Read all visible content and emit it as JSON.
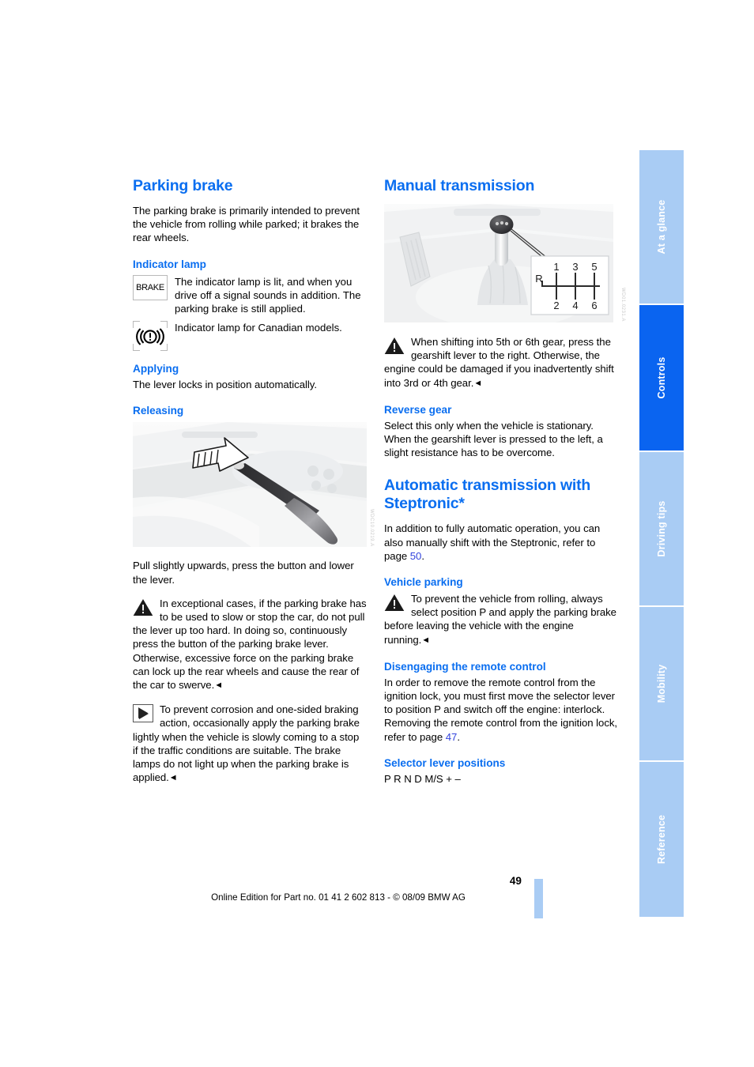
{
  "page": {
    "number": "49",
    "footer": "Online Edition for Part no. 01 41 2 602 813 - © 08/09 BMW AG"
  },
  "sidebar": {
    "tabs": [
      {
        "label": "At a glance",
        "active": false
      },
      {
        "label": "Controls",
        "active": true
      },
      {
        "label": "Driving tips",
        "active": false
      },
      {
        "label": "Mobility",
        "active": false
      },
      {
        "label": "Reference",
        "active": false
      }
    ]
  },
  "colors": {
    "heading_blue": "#0a6ef0",
    "tab_active": "#0a64f0",
    "tab_inactive": "#a9ccf4",
    "xref_blue": "#3344dd"
  },
  "left_column": {
    "title": "Parking brake",
    "intro": "The parking brake is primarily intended to prevent the vehicle from rolling while parked; it brakes the rear wheels.",
    "indicator_heading": "Indicator lamp",
    "lamp_brake_label": "BRAKE",
    "lamp_brake_text": "The indicator lamp is lit, and when you drive off a signal sounds in addition. The parking brake is still applied.",
    "lamp_canadian_glyph": "((!))",
    "lamp_canadian_text": "Indicator lamp for Canadian models.",
    "applying_heading": "Applying",
    "applying_text": "The lever locks in position automatically.",
    "releasing_heading": "Releasing",
    "figure_code": "WDC10.0219.A",
    "releasing_caption": "Pull slightly upwards, press the button and lower the lever.",
    "warning_text": "In exceptional cases, if the parking brake has to be used to slow or stop the car, do not pull the lever up too hard. In doing so, continuously press the button of the parking brake lever.",
    "warning_text2": "Otherwise, excessive force on the parking brake can lock up the rear wheels and cause the rear of the car to swerve.",
    "tip_text": "To prevent corrosion and one-sided braking action, occasionally apply the parking brake lightly when the vehicle is slowly coming to a stop if the traffic conditions are suitable. The brake lamps do not light up when the parking brake is applied.",
    "end_mark": "◄"
  },
  "right_column": {
    "manual_title": "Manual transmission",
    "manual_figure_code": "WD01.0231.A",
    "gear_pattern": {
      "top_row": [
        "R",
        "1",
        "3",
        "5"
      ],
      "bottom_row": [
        "2",
        "4",
        "6"
      ]
    },
    "manual_warning": "When shifting into 5th or 6th gear, press the gearshift lever to the right. Otherwise, the engine could be damaged if you inadvertently shift into 3rd or 4th gear.",
    "reverse_heading": "Reverse gear",
    "reverse_text": "Select this only when the vehicle is stationary. When the gearshift lever is pressed to the left, a slight resistance has to be overcome.",
    "auto_title_line1": "Automatic transmission with",
    "auto_title_line2": "Steptronic*",
    "auto_intro_before": "In addition to fully automatic operation, you can also manually shift with the Steptronic, refer to page ",
    "auto_intro_ref": "50",
    "auto_intro_after": ".",
    "vehicle_parking_heading": "Vehicle parking",
    "vehicle_parking_warning": "To prevent the vehicle from rolling, always select position P and apply the parking brake before leaving the vehicle with the engine running.",
    "disengaging_heading": "Disengaging the remote control",
    "disengaging_before": "In order to remove the remote control from the ignition lock, you must first move the selector lever to position P and switch off the engine: interlock. Removing the remote control from the ignition lock, refer to page ",
    "disengaging_ref": "47",
    "disengaging_after": ".",
    "selector_heading": "Selector lever positions",
    "selector_positions": "P R N D M/S + –",
    "end_mark": "◄"
  }
}
